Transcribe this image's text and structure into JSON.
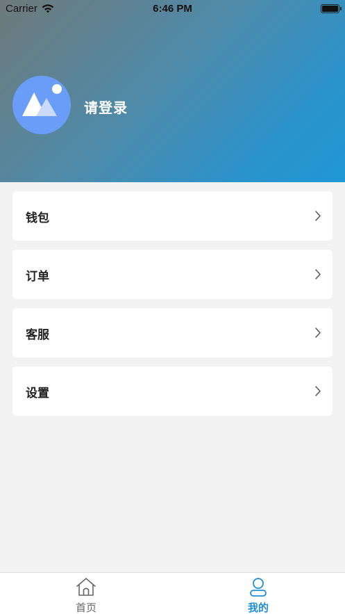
{
  "status_bar": {
    "carrier": "Carrier",
    "time": "6:46 PM"
  },
  "profile": {
    "avatar_icon": "image-placeholder-icon",
    "login_prompt": "请登录"
  },
  "menu": {
    "items": [
      {
        "label": "钱包",
        "icon": "chevron-right-icon"
      },
      {
        "label": "订单",
        "icon": "chevron-right-icon"
      },
      {
        "label": "客服",
        "icon": "chevron-right-icon"
      },
      {
        "label": "设置",
        "icon": "chevron-right-icon"
      }
    ]
  },
  "tabbar": {
    "tabs": [
      {
        "label": "首页",
        "icon": "home-icon",
        "active": false
      },
      {
        "label": "我的",
        "icon": "user-icon",
        "active": true
      }
    ]
  },
  "colors": {
    "accent": "#1e8fd6",
    "avatar_bg": "#6a9df7",
    "background": "#f2f2f2"
  }
}
